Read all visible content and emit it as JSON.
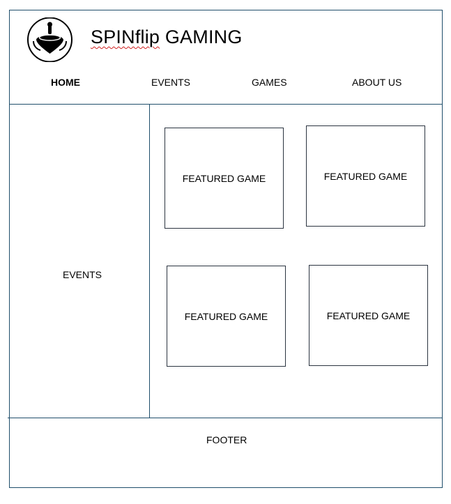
{
  "header": {
    "title_prefix": "SPINflip",
    "title_suffix": " GAMING",
    "logo_icon": "spinning-top-icon"
  },
  "nav": [
    {
      "label": "HOME",
      "active": true
    },
    {
      "label": "EVENTS",
      "active": false
    },
    {
      "label": "GAMES",
      "active": false
    },
    {
      "label": "ABOUT US",
      "active": false
    }
  ],
  "sidebar": {
    "label": "EVENTS"
  },
  "featured_games": [
    {
      "label": "FEATURED GAME"
    },
    {
      "label": "FEATURED GAME"
    },
    {
      "label": "FEATURED GAME"
    },
    {
      "label": "FEATURED GAME"
    }
  ],
  "footer": {
    "label": "FOOTER"
  },
  "colors": {
    "border": "#1f4e6b",
    "text": "#000000",
    "spellcheck_underline": "#d02020"
  }
}
